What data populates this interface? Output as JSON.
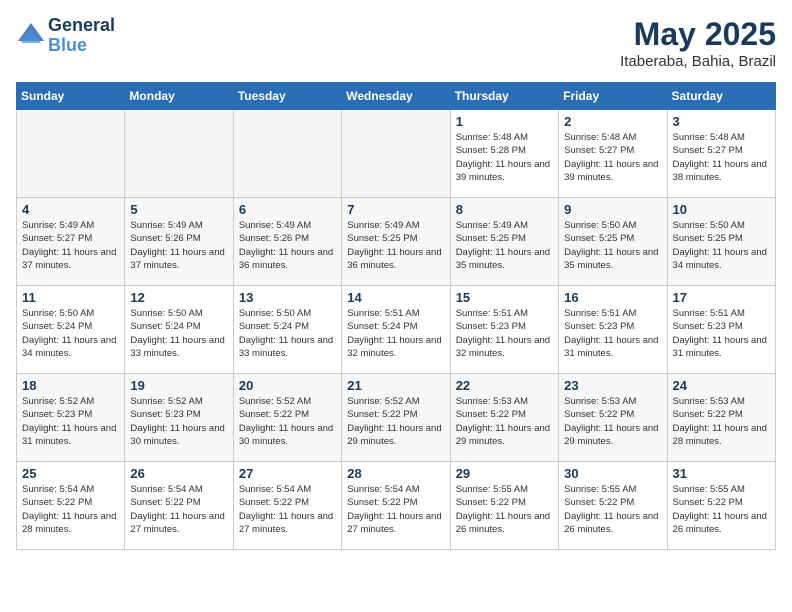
{
  "header": {
    "logo_line1": "General",
    "logo_line2": "Blue",
    "month": "May 2025",
    "location": "Itaberaba, Bahia, Brazil"
  },
  "weekdays": [
    "Sunday",
    "Monday",
    "Tuesday",
    "Wednesday",
    "Thursday",
    "Friday",
    "Saturday"
  ],
  "weeks": [
    [
      {
        "day": "",
        "empty": true
      },
      {
        "day": "",
        "empty": true
      },
      {
        "day": "",
        "empty": true
      },
      {
        "day": "",
        "empty": true
      },
      {
        "day": "1",
        "sunrise": "5:48 AM",
        "sunset": "5:28 PM",
        "daylight": "11 hours and 39 minutes."
      },
      {
        "day": "2",
        "sunrise": "5:48 AM",
        "sunset": "5:27 PM",
        "daylight": "11 hours and 39 minutes."
      },
      {
        "day": "3",
        "sunrise": "5:48 AM",
        "sunset": "5:27 PM",
        "daylight": "11 hours and 38 minutes."
      }
    ],
    [
      {
        "day": "4",
        "sunrise": "5:49 AM",
        "sunset": "5:27 PM",
        "daylight": "11 hours and 37 minutes."
      },
      {
        "day": "5",
        "sunrise": "5:49 AM",
        "sunset": "5:26 PM",
        "daylight": "11 hours and 37 minutes."
      },
      {
        "day": "6",
        "sunrise": "5:49 AM",
        "sunset": "5:26 PM",
        "daylight": "11 hours and 36 minutes."
      },
      {
        "day": "7",
        "sunrise": "5:49 AM",
        "sunset": "5:25 PM",
        "daylight": "11 hours and 36 minutes."
      },
      {
        "day": "8",
        "sunrise": "5:49 AM",
        "sunset": "5:25 PM",
        "daylight": "11 hours and 35 minutes."
      },
      {
        "day": "9",
        "sunrise": "5:50 AM",
        "sunset": "5:25 PM",
        "daylight": "11 hours and 35 minutes."
      },
      {
        "day": "10",
        "sunrise": "5:50 AM",
        "sunset": "5:25 PM",
        "daylight": "11 hours and 34 minutes."
      }
    ],
    [
      {
        "day": "11",
        "sunrise": "5:50 AM",
        "sunset": "5:24 PM",
        "daylight": "11 hours and 34 minutes."
      },
      {
        "day": "12",
        "sunrise": "5:50 AM",
        "sunset": "5:24 PM",
        "daylight": "11 hours and 33 minutes."
      },
      {
        "day": "13",
        "sunrise": "5:50 AM",
        "sunset": "5:24 PM",
        "daylight": "11 hours and 33 minutes."
      },
      {
        "day": "14",
        "sunrise": "5:51 AM",
        "sunset": "5:24 PM",
        "daylight": "11 hours and 32 minutes."
      },
      {
        "day": "15",
        "sunrise": "5:51 AM",
        "sunset": "5:23 PM",
        "daylight": "11 hours and 32 minutes."
      },
      {
        "day": "16",
        "sunrise": "5:51 AM",
        "sunset": "5:23 PM",
        "daylight": "11 hours and 31 minutes."
      },
      {
        "day": "17",
        "sunrise": "5:51 AM",
        "sunset": "5:23 PM",
        "daylight": "11 hours and 31 minutes."
      }
    ],
    [
      {
        "day": "18",
        "sunrise": "5:52 AM",
        "sunset": "5:23 PM",
        "daylight": "11 hours and 31 minutes."
      },
      {
        "day": "19",
        "sunrise": "5:52 AM",
        "sunset": "5:23 PM",
        "daylight": "11 hours and 30 minutes."
      },
      {
        "day": "20",
        "sunrise": "5:52 AM",
        "sunset": "5:22 PM",
        "daylight": "11 hours and 30 minutes."
      },
      {
        "day": "21",
        "sunrise": "5:52 AM",
        "sunset": "5:22 PM",
        "daylight": "11 hours and 29 minutes."
      },
      {
        "day": "22",
        "sunrise": "5:53 AM",
        "sunset": "5:22 PM",
        "daylight": "11 hours and 29 minutes."
      },
      {
        "day": "23",
        "sunrise": "5:53 AM",
        "sunset": "5:22 PM",
        "daylight": "11 hours and 29 minutes."
      },
      {
        "day": "24",
        "sunrise": "5:53 AM",
        "sunset": "5:22 PM",
        "daylight": "11 hours and 28 minutes."
      }
    ],
    [
      {
        "day": "25",
        "sunrise": "5:54 AM",
        "sunset": "5:22 PM",
        "daylight": "11 hours and 28 minutes."
      },
      {
        "day": "26",
        "sunrise": "5:54 AM",
        "sunset": "5:22 PM",
        "daylight": "11 hours and 27 minutes."
      },
      {
        "day": "27",
        "sunrise": "5:54 AM",
        "sunset": "5:22 PM",
        "daylight": "11 hours and 27 minutes."
      },
      {
        "day": "28",
        "sunrise": "5:54 AM",
        "sunset": "5:22 PM",
        "daylight": "11 hours and 27 minutes."
      },
      {
        "day": "29",
        "sunrise": "5:55 AM",
        "sunset": "5:22 PM",
        "daylight": "11 hours and 26 minutes."
      },
      {
        "day": "30",
        "sunrise": "5:55 AM",
        "sunset": "5:22 PM",
        "daylight": "11 hours and 26 minutes."
      },
      {
        "day": "31",
        "sunrise": "5:55 AM",
        "sunset": "5:22 PM",
        "daylight": "11 hours and 26 minutes."
      }
    ]
  ]
}
